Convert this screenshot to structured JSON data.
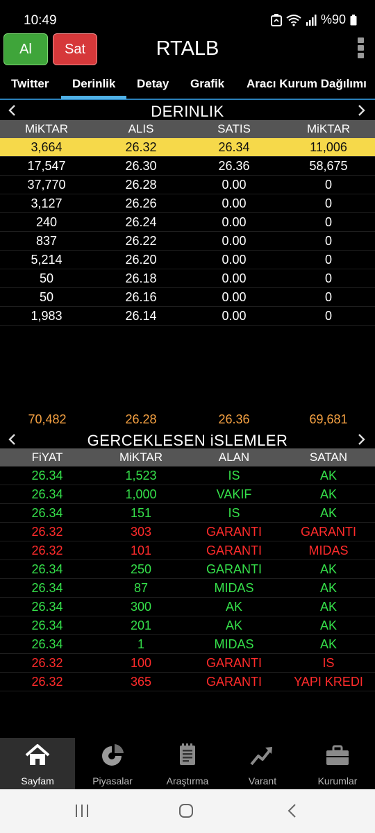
{
  "status_bar": {
    "time": "10:49",
    "battery": "%90"
  },
  "header": {
    "buy_label": "Al",
    "sell_label": "Sat",
    "symbol": "RTALB"
  },
  "tabs": [
    {
      "label": "Twitter",
      "active": false
    },
    {
      "label": "Derinlik",
      "active": true
    },
    {
      "label": "Detay",
      "active": false
    },
    {
      "label": "Grafik",
      "active": false
    },
    {
      "label": "Aracı Kurum Dağılımı",
      "active": false
    }
  ],
  "depth": {
    "title": "DERINLIK",
    "columns": [
      "MiKTAR",
      "ALIS",
      "SATIS",
      "MiKTAR"
    ],
    "rows": [
      [
        "3,664",
        "26.32",
        "26.34",
        "11,006"
      ],
      [
        "17,547",
        "26.30",
        "26.36",
        "58,675"
      ],
      [
        "37,770",
        "26.28",
        "0.00",
        "0"
      ],
      [
        "3,127",
        "26.26",
        "0.00",
        "0"
      ],
      [
        "240",
        "26.24",
        "0.00",
        "0"
      ],
      [
        "837",
        "26.22",
        "0.00",
        "0"
      ],
      [
        "5,214",
        "26.20",
        "0.00",
        "0"
      ],
      [
        "50",
        "26.18",
        "0.00",
        "0"
      ],
      [
        "50",
        "26.16",
        "0.00",
        "0"
      ],
      [
        "1,983",
        "26.14",
        "0.00",
        "0"
      ]
    ],
    "totals": [
      "70,482",
      "26.28",
      "26.36",
      "69,681"
    ]
  },
  "trades": {
    "title": "GERCEKLESEN iSLEMLER",
    "columns": [
      "FiYAT",
      "MiKTAR",
      "ALAN",
      "SATAN"
    ],
    "rows": [
      {
        "price": "26.34",
        "qty": "1,523",
        "buyer": "IS",
        "seller": "AK",
        "side": "up"
      },
      {
        "price": "26.34",
        "qty": "1,000",
        "buyer": "VAKIF",
        "seller": "AK",
        "side": "up"
      },
      {
        "price": "26.34",
        "qty": "151",
        "buyer": "IS",
        "seller": "AK",
        "side": "up"
      },
      {
        "price": "26.32",
        "qty": "303",
        "buyer": "GARANTI",
        "seller": "GARANTI",
        "side": "down"
      },
      {
        "price": "26.32",
        "qty": "101",
        "buyer": "GARANTI",
        "seller": "MIDAS",
        "side": "down"
      },
      {
        "price": "26.34",
        "qty": "250",
        "buyer": "GARANTI",
        "seller": "AK",
        "side": "up"
      },
      {
        "price": "26.34",
        "qty": "87",
        "buyer": "MIDAS",
        "seller": "AK",
        "side": "up"
      },
      {
        "price": "26.34",
        "qty": "300",
        "buyer": "AK",
        "seller": "AK",
        "side": "up"
      },
      {
        "price": "26.34",
        "qty": "201",
        "buyer": "AK",
        "seller": "AK",
        "side": "up"
      },
      {
        "price": "26.34",
        "qty": "1",
        "buyer": "MIDAS",
        "seller": "AK",
        "side": "up"
      },
      {
        "price": "26.32",
        "qty": "100",
        "buyer": "GARANTI",
        "seller": "IS",
        "side": "down"
      },
      {
        "price": "26.32",
        "qty": "365",
        "buyer": "GARANTI",
        "seller": "YAPI KREDI",
        "side": "down"
      }
    ]
  },
  "bottom_nav": [
    {
      "label": "Sayfam",
      "icon": "home-icon",
      "active": true
    },
    {
      "label": "Piyasalar",
      "icon": "pie-chart-icon",
      "active": false
    },
    {
      "label": "Araştırma",
      "icon": "report-icon",
      "active": false
    },
    {
      "label": "Varant",
      "icon": "trend-up-icon",
      "active": false
    },
    {
      "label": "Kurumlar",
      "icon": "briefcase-icon",
      "active": false
    }
  ],
  "colors": {
    "up": "#35e04a",
    "down": "#ff2b2b",
    "highlight": "#f6d94a",
    "totals": "#f5a142",
    "tab_accent": "#4fb0e6"
  }
}
